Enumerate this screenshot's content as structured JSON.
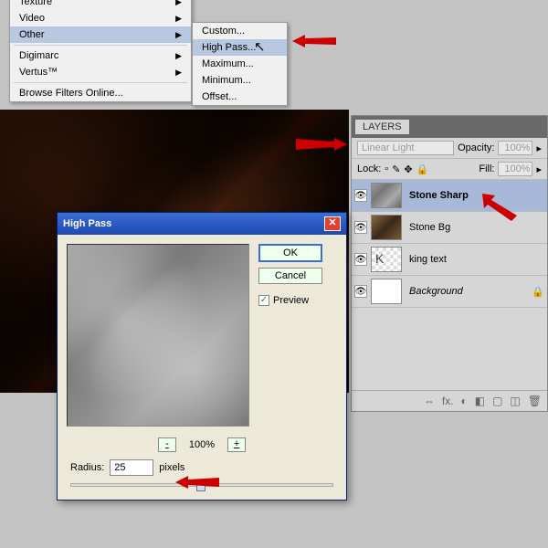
{
  "menu": {
    "col1": {
      "texture": "Texture",
      "video": "Video",
      "other": "Other",
      "digimarc": "Digimarc",
      "vertus": "Vertus™",
      "browse": "Browse Filters Online..."
    },
    "col2": {
      "custom": "Custom...",
      "highpass": "High Pass...",
      "maximum": "Maximum...",
      "minimum": "Minimum...",
      "offset": "Offset..."
    }
  },
  "layers": {
    "title": "LAYERS",
    "blend_mode": "Linear Light",
    "opacity_label": "Opacity:",
    "opacity_value": "100%",
    "lock_label": "Lock:",
    "fill_label": "Fill:",
    "fill_value": "100%",
    "items": [
      {
        "name": "Stone Sharp"
      },
      {
        "name": "Stone Bg"
      },
      {
        "name": "king text"
      },
      {
        "name": "Background"
      }
    ],
    "footer_icons": [
      "⇔",
      "fx.",
      "◐",
      "◧",
      "▢",
      "◫",
      "🗑"
    ]
  },
  "dialog": {
    "title": "High Pass",
    "ok": "OK",
    "cancel": "Cancel",
    "preview": "Preview",
    "zoom_minus": "-",
    "zoom_value": "100%",
    "zoom_plus": "+",
    "radius_label": "Radius:",
    "radius_value": "25",
    "radius_unit": "pixels"
  }
}
